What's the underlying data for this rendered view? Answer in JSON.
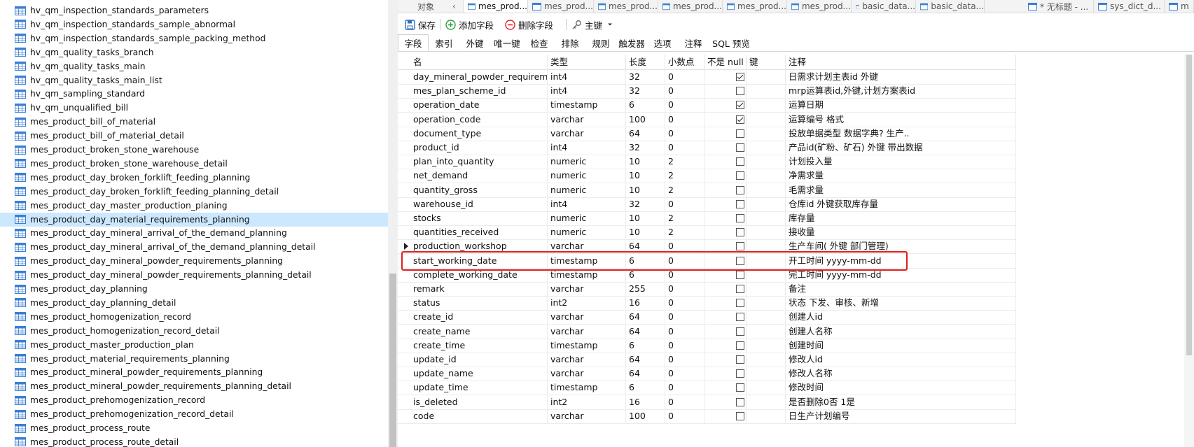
{
  "tree": {
    "selected_index": 15,
    "items": [
      "hv_qm_inspection_standards_parameters",
      "hv_qm_inspection_standards_sample_abnormal",
      "hv_qm_inspection_standards_sample_packing_method",
      "hv_qm_quality_tasks_branch",
      "hv_qm_quality_tasks_main",
      "hv_qm_quality_tasks_main_list",
      "hv_qm_sampling_standard",
      "hv_qm_unqualified_bill",
      "mes_product_bill_of_material",
      "mes_product_bill_of_material_detail",
      "mes_product_broken_stone_warehouse",
      "mes_product_broken_stone_warehouse_detail",
      "mes_product_day_broken_forklift_feeding_planning",
      "mes_product_day_broken_forklift_feeding_planning_detail",
      "mes_product_day_master_production_planing",
      "mes_product_day_material_requirements_planning",
      "mes_product_day_mineral_arrival_of_the_demand_planning",
      "mes_product_day_mineral_arrival_of_the_demand_planning_detail",
      "mes_product_day_mineral_powder_requirements_planning",
      "mes_product_day_mineral_powder_requirements_planning_detail",
      "mes_product_day_planning",
      "mes_product_day_planning_detail",
      "mes_product_homogenization_record",
      "mes_product_homogenization_record_detail",
      "mes_product_master_production_plan",
      "mes_product_material_requirements_planning",
      "mes_product_mineral_powder_requirements_planning",
      "mes_product_mineral_powder_requirements_planning_detail",
      "mes_product_prehomogenization_record",
      "mes_product_prehomogenization_record_detail",
      "mes_product_process_route",
      "mes_product_process_route_detail"
    ]
  },
  "tabs": [
    "对象",
    "mes_prod...",
    "mes_prod...",
    "mes_prod...",
    "mes_prod...",
    "mes_prod...",
    "mes_prod...",
    "basic_data...",
    "basic_data...",
    "* 无标题 - ...",
    "sys_dict_d...",
    "m"
  ],
  "toolbar": {
    "save": "保存",
    "add_field": "添加字段",
    "delete_field": "删除字段",
    "primary_key": "主键"
  },
  "subtabs": [
    "字段",
    "索引",
    "外键",
    "唯一键",
    "检查",
    "排除",
    "规则",
    "触发器",
    "选项",
    "注释",
    "SQL 预览"
  ],
  "grid": {
    "headers": [
      "名",
      "类型",
      "长度",
      "小数点",
      "不是 null",
      "键",
      "注释"
    ],
    "current_row": 12,
    "rows": [
      {
        "name": "day_mineral_powder_requirements",
        "type": "int4",
        "length": "32",
        "decimals": "0",
        "not_null": true,
        "comment": "日需求计划主表id   外键"
      },
      {
        "name": "mes_plan_scheme_id",
        "type": "int4",
        "length": "32",
        "decimals": "0",
        "not_null": false,
        "comment": "mrp运算表id,外键,计划方案表id"
      },
      {
        "name": "operation_date",
        "type": "timestamp",
        "length": "6",
        "decimals": "0",
        "not_null": true,
        "comment": "运算日期"
      },
      {
        "name": "operation_code",
        "type": "varchar",
        "length": "100",
        "decimals": "0",
        "not_null": true,
        "comment": "运算编号 格式"
      },
      {
        "name": "document_type",
        "type": "varchar",
        "length": "64",
        "decimals": "0",
        "not_null": false,
        "comment": "投放单据类型 数据字典? 生产.."
      },
      {
        "name": "product_id",
        "type": "int4",
        "length": "32",
        "decimals": "0",
        "not_null": false,
        "comment": "产品id(矿粉、矿石) 外键 带出数据"
      },
      {
        "name": "plan_into_quantity",
        "type": "numeric",
        "length": "10",
        "decimals": "2",
        "not_null": false,
        "comment": "计划投入量"
      },
      {
        "name": "net_demand",
        "type": "numeric",
        "length": "10",
        "decimals": "2",
        "not_null": false,
        "comment": "净需求量"
      },
      {
        "name": "quantity_gross",
        "type": "numeric",
        "length": "10",
        "decimals": "2",
        "not_null": false,
        "comment": "毛需求量"
      },
      {
        "name": "warehouse_id",
        "type": "int4",
        "length": "32",
        "decimals": "0",
        "not_null": false,
        "comment": "仓库id  外键获取库存量"
      },
      {
        "name": "stocks",
        "type": "numeric",
        "length": "10",
        "decimals": "2",
        "not_null": false,
        "comment": "库存量"
      },
      {
        "name": "quantities_received",
        "type": "numeric",
        "length": "10",
        "decimals": "2",
        "not_null": false,
        "comment": "接收量"
      },
      {
        "name": "production_workshop",
        "type": "varchar",
        "length": "64",
        "decimals": "0",
        "not_null": false,
        "comment": "生产车间( 外键 部门管理)"
      },
      {
        "name": "start_working_date",
        "type": "timestamp",
        "length": "6",
        "decimals": "0",
        "not_null": false,
        "comment": "开工时间 yyyy-mm-dd"
      },
      {
        "name": "complete_working_date",
        "type": "timestamp",
        "length": "6",
        "decimals": "0",
        "not_null": false,
        "comment": "完工时间 yyyy-mm-dd"
      },
      {
        "name": "remark",
        "type": "varchar",
        "length": "255",
        "decimals": "0",
        "not_null": false,
        "comment": "备注"
      },
      {
        "name": "status",
        "type": "int2",
        "length": "16",
        "decimals": "0",
        "not_null": false,
        "comment": "状态 下发、审核、新增"
      },
      {
        "name": "create_id",
        "type": "varchar",
        "length": "64",
        "decimals": "0",
        "not_null": false,
        "comment": "创建人id"
      },
      {
        "name": "create_name",
        "type": "varchar",
        "length": "64",
        "decimals": "0",
        "not_null": false,
        "comment": "创建人名称"
      },
      {
        "name": "create_time",
        "type": "timestamp",
        "length": "6",
        "decimals": "0",
        "not_null": false,
        "comment": "创建时间"
      },
      {
        "name": "update_id",
        "type": "varchar",
        "length": "64",
        "decimals": "0",
        "not_null": false,
        "comment": "修改人id"
      },
      {
        "name": "update_name",
        "type": "varchar",
        "length": "64",
        "decimals": "0",
        "not_null": false,
        "comment": "修改人名称"
      },
      {
        "name": "update_time",
        "type": "timestamp",
        "length": "6",
        "decimals": "0",
        "not_null": false,
        "comment": "修改时间"
      },
      {
        "name": "is_deleted",
        "type": "int2",
        "length": "16",
        "decimals": "0",
        "not_null": false,
        "comment": "是否删除0否 1是"
      },
      {
        "name": "code",
        "type": "varchar",
        "length": "100",
        "decimals": "0",
        "not_null": false,
        "comment": "日生产计划编号"
      }
    ]
  },
  "colors": {
    "selected_row": "#cce8ff",
    "highlight_border": "#e0201b",
    "table_icon": "#3b7fd1"
  }
}
